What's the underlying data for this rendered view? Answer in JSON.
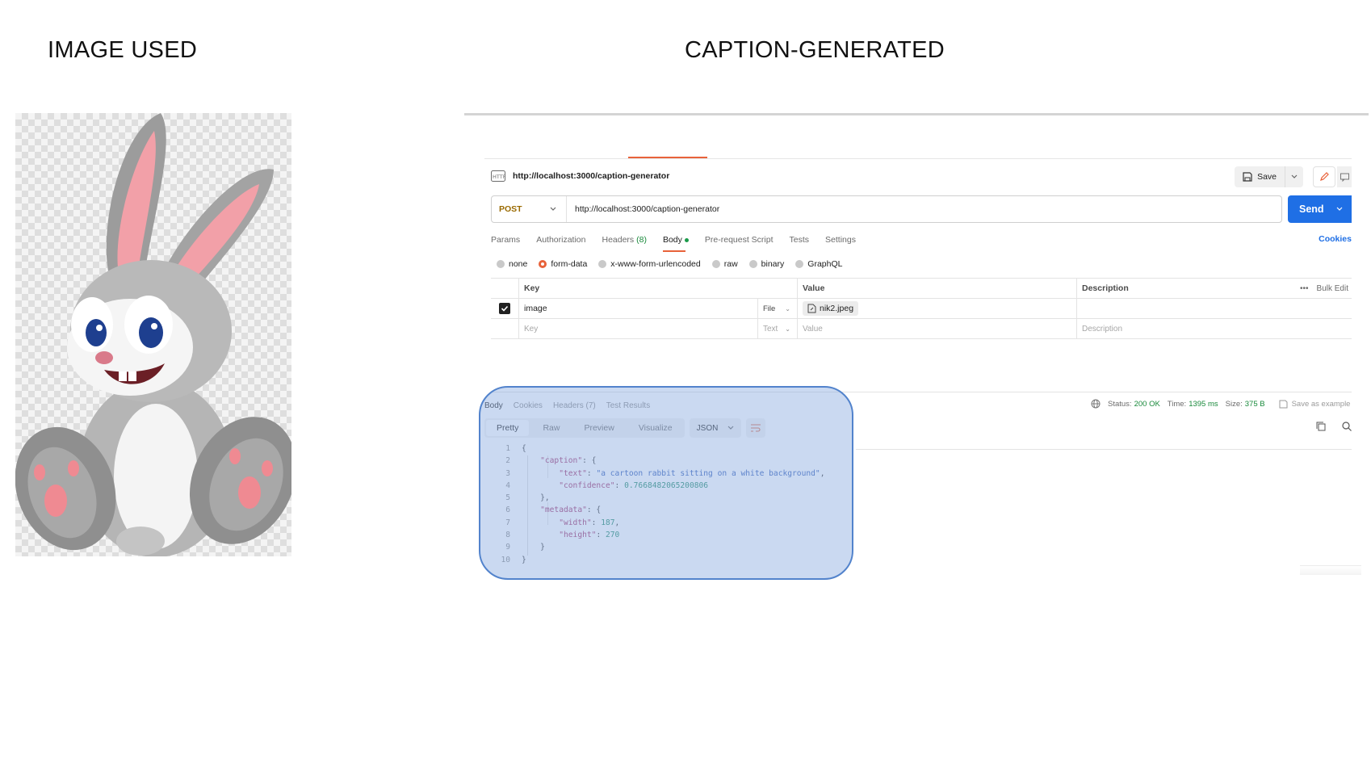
{
  "headings": {
    "left": "IMAGE USED",
    "right": "CAPTION-GENERATED"
  },
  "request": {
    "title": "http://localhost:3000/caption-generator",
    "method": "POST",
    "url": "http://localhost:3000/caption-generator",
    "save_label": "Save",
    "send_label": "Send"
  },
  "request_tabs": {
    "params": "Params",
    "authorization": "Authorization",
    "headers": "Headers",
    "headers_count": "(8)",
    "body": "Body",
    "prerequest": "Pre-request Script",
    "tests": "Tests",
    "settings": "Settings",
    "cookies": "Cookies"
  },
  "body_types": {
    "none": "none",
    "form_data": "form-data",
    "urlencoded": "x-www-form-urlencoded",
    "raw": "raw",
    "binary": "binary",
    "graphql": "GraphQL",
    "selected": "form-data"
  },
  "kv_table": {
    "headers": {
      "key": "Key",
      "value": "Value",
      "description": "Description",
      "bulk_edit": "Bulk Edit"
    },
    "row1": {
      "key": "image",
      "type": "File",
      "value": "nik2.jpeg",
      "checked": true
    },
    "empty": {
      "key": "Key",
      "type": "Text",
      "value": "Value",
      "description": "Description"
    }
  },
  "response_tabs": {
    "body": "Body",
    "cookies": "Cookies",
    "headers": "Headers (7)",
    "test_results": "Test Results"
  },
  "status": {
    "status_label": "Status:",
    "status_value": "200 OK",
    "time_label": "Time:",
    "time_value": "1395 ms",
    "size_label": "Size:",
    "size_value": "375 B",
    "save_example": "Save as example"
  },
  "view_modes": {
    "pretty": "Pretty",
    "raw": "Raw",
    "preview": "Preview",
    "visualize": "Visualize",
    "format": "JSON"
  },
  "code": {
    "line_numbers": [
      "1",
      "2",
      "3",
      "4",
      "5",
      "6",
      "7",
      "8",
      "9",
      "10"
    ],
    "l1": "{",
    "caption_key": "\"caption\"",
    "text_key": "\"text\"",
    "text_value": "\"a cartoon rabbit sitting on a white background\"",
    "confidence_key": "\"confidence\"",
    "confidence_value": "0.7668482065200806",
    "close_obj": "},",
    "metadata_key": "\"metadata\"",
    "width_key": "\"width\"",
    "width_value": "187",
    "height_key": "\"height\"",
    "height_value": "270",
    "l9": "}",
    "l10": "}"
  },
  "colors": {
    "accent": "#e8623a",
    "send": "#1f6fe5",
    "success": "#1a8a3c",
    "highlight": "#5283cc"
  },
  "icons": [
    "http-icon",
    "save-icon",
    "chevron-down-icon",
    "pencil-icon",
    "comment-icon",
    "checkbox-icon",
    "file-icon",
    "more-icon",
    "globe-icon",
    "wrap-icon",
    "copy-icon",
    "search-icon"
  ]
}
